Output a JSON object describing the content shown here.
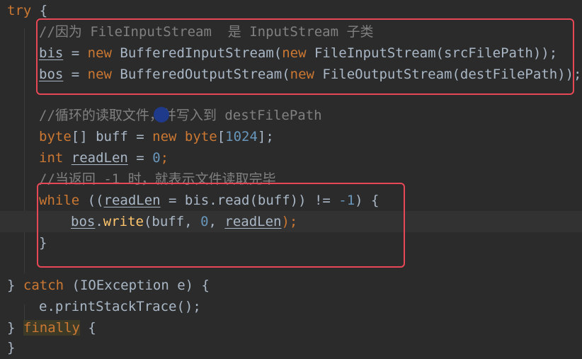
{
  "code": {
    "l1_try": "try",
    "brace_open": "{",
    "brace_close": "}",
    "l2_comment": "//因为 FileInputStream  是 InputStream 子类",
    "l3": {
      "var": "bis",
      "eq": " = ",
      "new1": "new",
      "cls1": " BufferedInputStream(",
      "new2": "new",
      "cls2": " FileInputStream(srcFilePath));"
    },
    "l4": {
      "var": "bos",
      "eq": " = ",
      "new1": "new",
      "cls1": " BufferedOutputStream(",
      "new2": "new",
      "cls2": " FileOutputStream(destFilePath));"
    },
    "l5_comment": "//循环的读取文件，并写入到 destFilePath",
    "l6": {
      "type": "byte",
      "mid": "[] buff = ",
      "new": "new",
      "type2": " byte",
      "lb": "[",
      "num": "1024",
      "rb": "];"
    },
    "l7": {
      "type": "int",
      "var": "readLen",
      "eq": " = ",
      "num": "0",
      "semi": ";"
    },
    "l8_comment": "//当返回 -1 时，就表示文件读取完毕",
    "l9": {
      "kw": "while",
      "a": " ((",
      "var": "readLen",
      "b": " = bis.read(buff)) != ",
      "num": "-1",
      "c": ") {"
    },
    "l10": {
      "obj": "bos",
      "dot": ".",
      "fn": "write",
      "a": "(buff, ",
      "num": "0",
      "b": ", ",
      "var": "readLen",
      "c": ");"
    },
    "l11": "}",
    "l12": {
      "close": "} ",
      "kw": "catch",
      "rest": " (IOException e) {"
    },
    "l13": "e.printStackTrace();",
    "l14": {
      "close": "} ",
      "kw": "finally",
      "rest": " {"
    },
    "l15": "}"
  },
  "colors": {
    "background": "#2b2b2b",
    "keyword": "#cc7832",
    "number": "#6897bb",
    "comment": "#808080",
    "field": "#9876aa",
    "method": "#ffc66d",
    "highlight_box": "#e84855"
  }
}
